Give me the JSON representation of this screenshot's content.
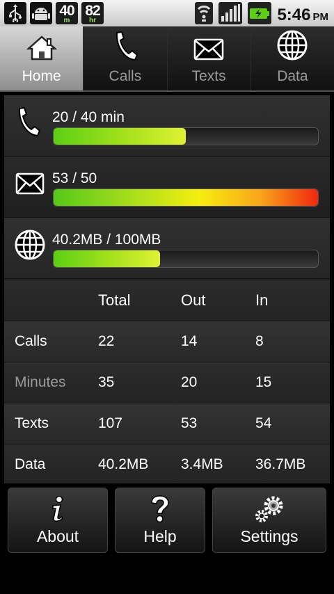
{
  "status_bar": {
    "minutes_left": "40",
    "minutes_unit": "m",
    "hours_left": "82",
    "hours_unit": "hr",
    "time": "5:46",
    "ampm": "PM"
  },
  "tabs": [
    {
      "label": "Home",
      "icon": "home-icon",
      "active": true
    },
    {
      "label": "Calls",
      "icon": "phone-icon",
      "active": false
    },
    {
      "label": "Texts",
      "icon": "envelope-icon",
      "active": false
    },
    {
      "label": "Data",
      "icon": "globe-icon",
      "active": false
    }
  ],
  "usage": {
    "calls": {
      "text": "20 / 40 min",
      "fraction": 0.5
    },
    "texts": {
      "text": "53 / 50",
      "fraction": 1.0
    },
    "data": {
      "text": "40.2MB / 100MB",
      "fraction": 0.402
    }
  },
  "table": {
    "headers": [
      "",
      "Total",
      "Out",
      "In"
    ],
    "rows": [
      [
        "Calls",
        "22",
        "14",
        "8"
      ],
      [
        "Minutes",
        "35",
        "20",
        "15"
      ],
      [
        "Texts",
        "107",
        "53",
        "54"
      ],
      [
        "Data",
        "40.2MB",
        "3.4MB",
        "36.7MB"
      ]
    ]
  },
  "buttons": {
    "about": "About",
    "help": "Help",
    "settings": "Settings"
  },
  "colors": {
    "bar_green": "#8fd81a",
    "bar_over_red": "#f0280f",
    "active_tab": "#b5b5b5"
  }
}
